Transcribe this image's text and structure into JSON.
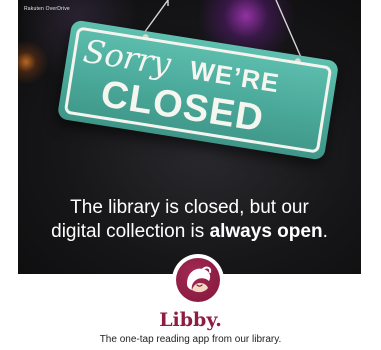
{
  "brand": {
    "label": "Rakuten OverDrive"
  },
  "sign": {
    "sorry": "Sorry",
    "were": "WE’RE",
    "closed": "CLOSED"
  },
  "headline": {
    "line1": "The library is closed, but our",
    "line2_prefix": "digital collection is ",
    "line2_bold": "always open",
    "line2_suffix": "."
  },
  "app": {
    "name": "Libby.",
    "tagline": "The one-tap reading app from our library."
  },
  "colors": {
    "libby_brand": "#8d1d44",
    "sign_teal": "#4aa99a",
    "background_dark": "#161618"
  },
  "icons": {
    "logo": "libby-logo-icon"
  }
}
